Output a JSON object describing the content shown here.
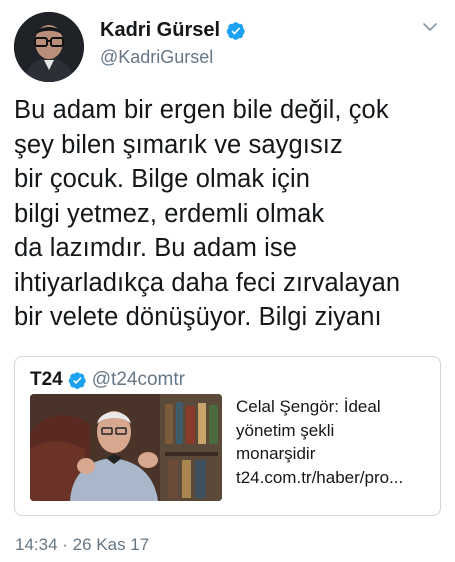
{
  "author": {
    "name": "Kadri Gürsel",
    "handle": "@KadriGursel",
    "verified_color": "#1da1f2"
  },
  "tweet": {
    "lines": [
      "Bu adam bir ergen bile değil, çok",
      "şey bilen şımarık ve saygısız",
      "bir çocuk. Bilge olmak için",
      "bilgi yetmez, erdemli olmak",
      "da lazımdır. Bu adam ise",
      "ihtiyarladıkça daha feci zırvalayan",
      "bir velete dönüşüyor. Bilgi ziyanı"
    ]
  },
  "quoted": {
    "name": "T24",
    "handle": "@t24comtr",
    "title_lines": [
      "Celal Şengör: İdeal",
      "yönetim şekli",
      "monarşidir"
    ],
    "link": "t24.com.tr/haber/pro..."
  },
  "meta": {
    "timestamp": "14:34 · 26 Kas 17"
  },
  "icons": {
    "verified": "verified-badge-icon",
    "menu": "chevron-down-icon"
  }
}
